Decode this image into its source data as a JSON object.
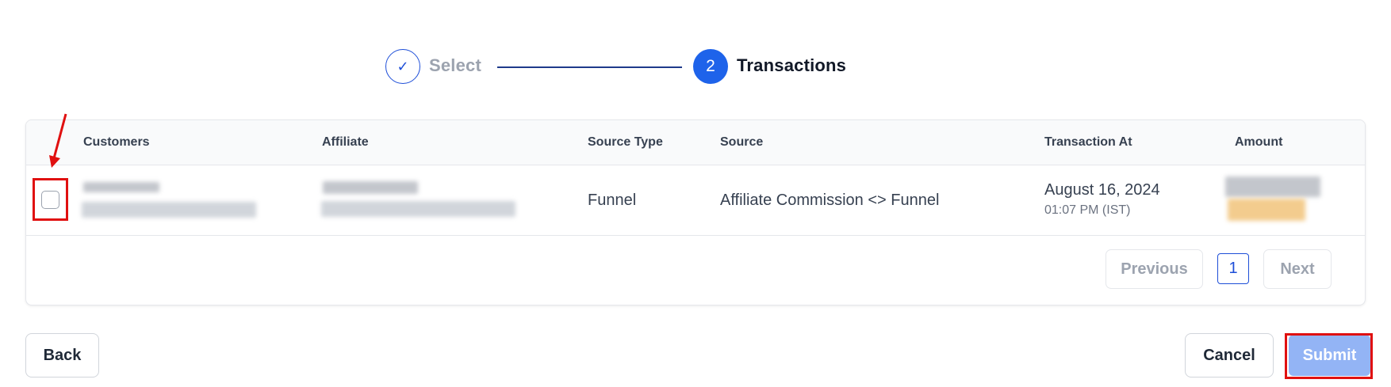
{
  "stepper": {
    "step1": {
      "icon": "check-icon",
      "icon_glyph": "✓",
      "label": "Select",
      "state": "completed"
    },
    "step2": {
      "number": "2",
      "label": "Transactions",
      "state": "active"
    }
  },
  "table": {
    "headers": {
      "customers": "Customers",
      "affiliate": "Affiliate",
      "source_type": "Source Type",
      "source": "Source",
      "transaction_at": "Transaction At",
      "amount": "Amount"
    },
    "rows": [
      {
        "checked": false,
        "customer": "redacted",
        "affiliate": "redacted",
        "source_type": "Funnel",
        "source": "Affiliate Commission <> Funnel",
        "date": "August 16, 2024",
        "time": "01:07 PM (IST)",
        "amount": "redacted"
      }
    ]
  },
  "pagination": {
    "previous_label": "Previous",
    "current_page": "1",
    "next_label": "Next"
  },
  "footer": {
    "back_label": "Back",
    "cancel_label": "Cancel",
    "submit_label": "Submit"
  },
  "colors": {
    "primary": "#1e63ea",
    "submit_disabled": "#93b4f5",
    "annotation": "#e01010"
  }
}
